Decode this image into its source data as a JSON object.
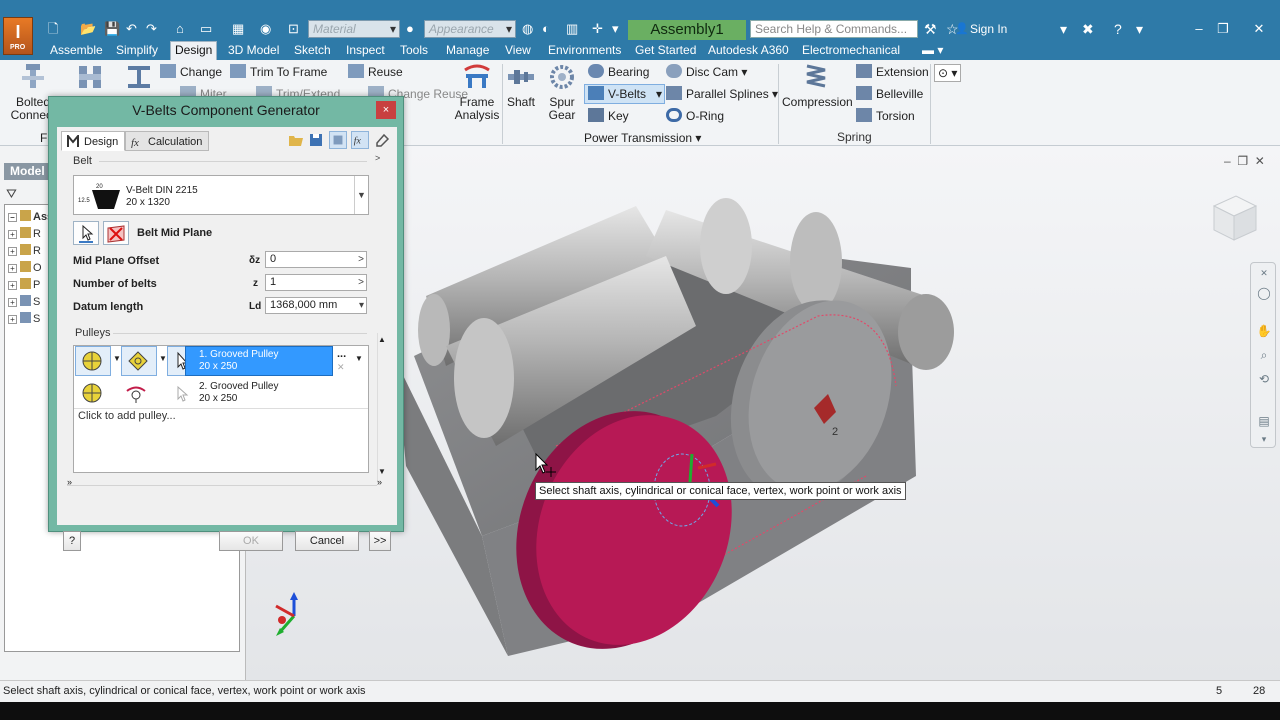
{
  "window": {
    "doc_title": "Assembly1",
    "material_placeholder": "Material",
    "appearance_placeholder": "Appearance",
    "search_placeholder": "Search Help & Commands...",
    "sign_in": "Sign In",
    "logo_badge": "PRO"
  },
  "menu_tabs": [
    "Assemble",
    "Simplify",
    "Design",
    "3D Model",
    "Sketch",
    "Inspect",
    "Tools",
    "Manage",
    "View",
    "Environments",
    "Get Started",
    "Autodesk A360",
    "Electromechanical"
  ],
  "active_tab": "Design",
  "ribbon": {
    "bolted_top": "Bolted",
    "bolted_bottom": "Connect",
    "frame_change": "Change",
    "trim_to_frame": "Trim To Frame",
    "reuse": "Reuse",
    "miter": "Miter",
    "trim_extend": "Trim/Extend",
    "change_reuse": "Change Reuse",
    "frame_analysis_top": "Frame",
    "frame_analysis_bottom": "Analysis",
    "shaft": "Shaft",
    "spur_gear_top": "Spur",
    "spur_gear_bottom": "Gear",
    "bearing": "Bearing",
    "v_belts": "V-Belts",
    "key": "Key",
    "disc_cam": "Disc Cam",
    "parallel_splines": "Parallel Splines",
    "o_ring": "O-Ring",
    "power_transmission": "Power Transmission",
    "compression": "Compression",
    "extension": "Extension",
    "belleville": "Belleville",
    "torsion": "Torsion",
    "spring": "Spring",
    "first_panel_partial": "F"
  },
  "browser": {
    "model_tab": "Model",
    "root": "Asse",
    "items": [
      "R",
      "R",
      "O",
      "P",
      "S",
      "S"
    ]
  },
  "dialog": {
    "title": "V-Belts Component Generator",
    "close": "×",
    "tab_design": "Design",
    "tab_calculation": "Calculation",
    "belt_group": "Belt",
    "belt_name": "V-Belt DIN 2215",
    "belt_size": "20 x 1320",
    "belt_dim_top": "20",
    "belt_dim_side": "12.5",
    "belt_mid_plane": "Belt Mid Plane",
    "mid_plane_offset_label": "Mid Plane Offset",
    "mid_plane_offset_sym": "δz",
    "mid_plane_offset_value": "0",
    "number_of_belts_label": "Number of belts",
    "number_of_belts_sym": "z",
    "number_of_belts_value": "1",
    "datum_length_label": "Datum length",
    "datum_length_sym": "Ld",
    "datum_length_value": "1368,000 mm",
    "pulleys_group": "Pulleys",
    "pulleys": [
      {
        "name": "1. Grooved Pulley",
        "size": "20 x 250"
      },
      {
        "name": "2. Grooved Pulley",
        "size": "20 x 250"
      }
    ],
    "add_pulley": "Click to add pulley...",
    "ok": "OK",
    "cancel": "Cancel",
    "more": ">>",
    "help": "?",
    "ellipsis": "..."
  },
  "viewport": {
    "tooltip": "Select shaft axis, cylindrical or conical face, vertex, work point or work axis",
    "pulley_label": "2"
  },
  "status": {
    "message": "Select shaft axis, cylindrical or conical face, vertex, work point or work axis",
    "count1": "5",
    "count2": "28"
  },
  "colors": {
    "title_bar": "#2e7aa8",
    "dialog_frame": "#73b8a4",
    "pulley_selected": "#c2185b",
    "selection_blue": "#3399ff"
  }
}
